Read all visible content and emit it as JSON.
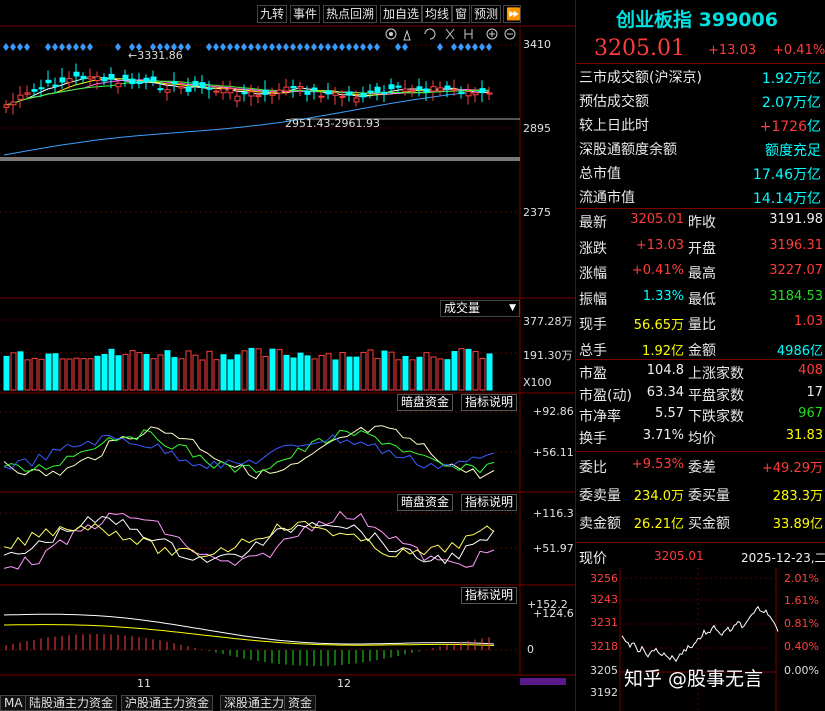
{
  "toolbar": {
    "buttons": [
      "九转",
      "事件",
      "热点回溯",
      "加自选",
      "均线",
      "窗",
      "预测"
    ]
  },
  "main_chart": {
    "price_axis": [
      "3410",
      "2895",
      "2375"
    ],
    "high_label": "3331.86",
    "range_label": "2951.43-2961.93"
  },
  "volume": {
    "dropdown": "成交量",
    "axis": [
      "377.28万",
      "191.30万"
    ],
    "multiplier": "X100"
  },
  "ind1": {
    "btn1": "暗盘资金",
    "btn2": "指标说明",
    "axis": [
      "+92.86",
      "+56.11"
    ]
  },
  "ind2": {
    "btn1": "暗盘资金",
    "btn2": "指标说明",
    "axis": [
      "+116.3",
      "+51.97"
    ]
  },
  "ind3": {
    "btn": "指标说明",
    "axis": [
      "+152.2",
      "+124.6",
      "0"
    ]
  },
  "xaxis": {
    "labels": [
      "11",
      "12"
    ]
  },
  "bottom_tabs": [
    "MA",
    "陆股通主力资金",
    "沪股通主力资金",
    "深股通主力资金",
    "资金"
  ],
  "right": {
    "title": "创业板指",
    "code": "399006",
    "price": "3205.01",
    "change": "+13.03",
    "pct": "+0.41%",
    "stats": [
      {
        "label": "三市成交额(沪深京)",
        "value": "1.92",
        "unit": "万亿"
      },
      {
        "label": "预估成交额",
        "value": "2.07",
        "unit": "万亿"
      },
      {
        "label": "较上日此时",
        "value": "+1726",
        "unit": "亿"
      },
      {
        "label": "深股通额度余额",
        "value": "额度充足",
        "unit": ""
      },
      {
        "label": "总市值",
        "value": "17.46",
        "unit": "万亿"
      },
      {
        "label": "流通市值",
        "value": "14.14",
        "unit": "万亿"
      }
    ],
    "quote": [
      {
        "l1": "最新",
        "v1": "3205.01",
        "l2": "昨收",
        "v2": "3191.98",
        "c1": "red",
        "c2": "white"
      },
      {
        "l1": "涨跌",
        "v1": "+13.03",
        "l2": "开盘",
        "v2": "3196.31",
        "c1": "red",
        "c2": "red"
      },
      {
        "l1": "涨幅",
        "v1": "+0.41%",
        "l2": "最高",
        "v2": "3227.07",
        "c1": "red",
        "c2": "red"
      },
      {
        "l1": "振幅",
        "v1": "1.33%",
        "l2": "最低",
        "v2": "3184.53",
        "c1": "cyan",
        "c2": "green"
      },
      {
        "l1": "现手",
        "v1": "56.65万",
        "l2": "量比",
        "v2": "1.03",
        "c1": "yel",
        "c2": "red"
      },
      {
        "l1": "总手",
        "v1": "1.92亿",
        "l2": "金额",
        "v2": "4986亿",
        "c1": "yel",
        "c2": "cyan"
      }
    ],
    "market": [
      {
        "l1": "市盈",
        "v1": "104.8",
        "l2": "上涨家数",
        "v2": "408",
        "c2": "red"
      },
      {
        "l1": "市盈(动)",
        "v1": "63.34",
        "l2": "平盘家数",
        "v2": "17",
        "c2": "white"
      },
      {
        "l1": "市净率",
        "v1": "5.57",
        "l2": "下跌家数",
        "v2": "967",
        "c2": "green"
      },
      {
        "l1": "换手",
        "v1": "3.71%",
        "l2": "均价",
        "v2": "31.83",
        "c2": "yel"
      }
    ],
    "orders": [
      {
        "l1": "委比",
        "v1": "+9.53%",
        "l2": "委差",
        "v2": "+49.29万",
        "c": "red"
      },
      {
        "l1": "委卖量",
        "v1": "234.0万",
        "l2": "委买量",
        "v2": "283.3万",
        "c": "yel"
      },
      {
        "l1": "卖金额",
        "v1": "26.21亿",
        "l2": "买金额",
        "v2": "33.89亿",
        "c": "yel"
      }
    ],
    "intraday": {
      "label": "现价",
      "price": "3205.01",
      "date": "2025-12-23,二",
      "left_axis": [
        "3256",
        "3243",
        "3231",
        "3218",
        "3205",
        "3192"
      ],
      "right_axis": [
        "2.01%",
        "1.61%",
        "0.81%",
        "0.40%",
        "0.00%"
      ]
    },
    "watermark": "知乎 @股事无言"
  }
}
